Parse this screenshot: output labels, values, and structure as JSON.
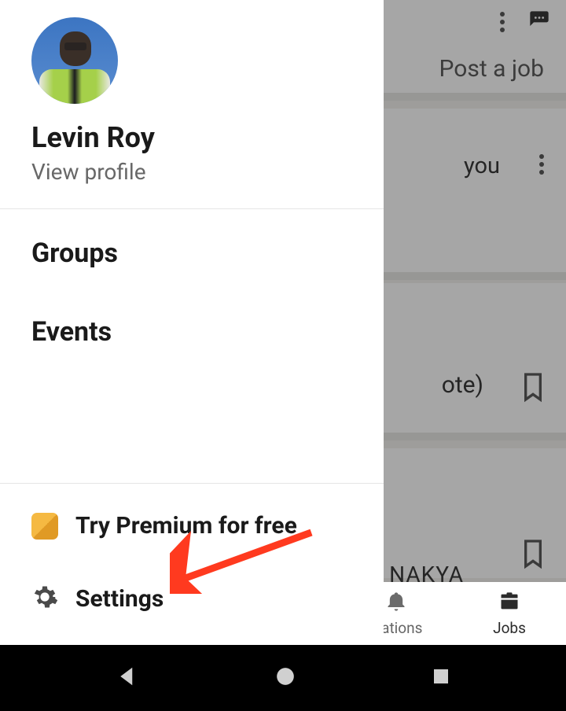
{
  "profile": {
    "name": "Levin Roy",
    "view_profile": "View profile"
  },
  "menu": {
    "groups": "Groups",
    "events": "Events"
  },
  "footer": {
    "premium": "Try Premium for free",
    "settings": "Settings"
  },
  "background": {
    "post_a_job_partial": "Post a job",
    "section1_partial": "you",
    "section2_partial": "ote)",
    "section3_partial": "NAKYA",
    "nav_notifications_partial": "ications",
    "nav_jobs": "Jobs"
  }
}
